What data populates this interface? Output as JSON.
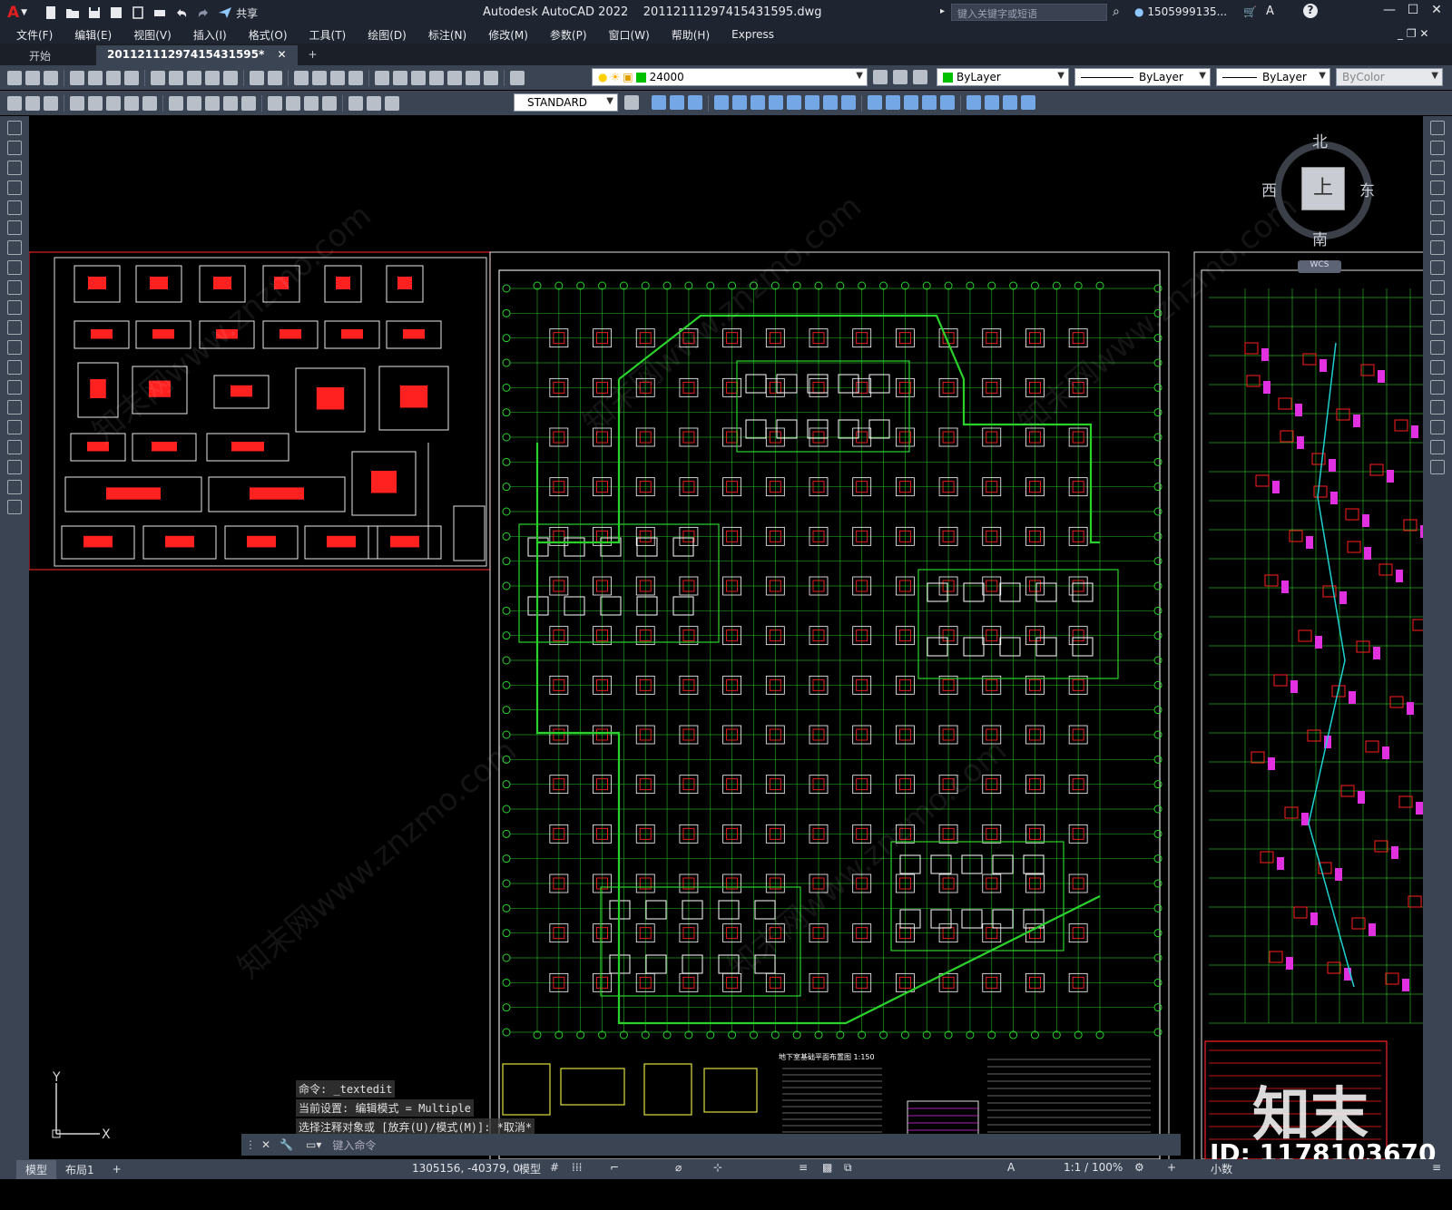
{
  "titlebar": {
    "app": "Autodesk AutoCAD 2022",
    "file": "20112111297415431595.dwg",
    "share": "共享",
    "search_placeholder": "键入关键字或短语",
    "user": "1505999135..."
  },
  "menubar": {
    "items": [
      "文件(F)",
      "编辑(E)",
      "视图(V)",
      "插入(I)",
      "格式(O)",
      "工具(T)",
      "绘图(D)",
      "标注(N)",
      "修改(M)",
      "参数(P)",
      "窗口(W)",
      "帮助(H)",
      "Express"
    ]
  },
  "tabs": {
    "start": "开始",
    "doc": "20112111297415431595*",
    "add": "+"
  },
  "toolbar": {
    "layer": "24000",
    "color": "ByLayer",
    "linetype": "ByLayer",
    "lineweight": "ByLayer",
    "plotstyle": "ByColor",
    "textstyle": "STANDARD"
  },
  "viewcube": {
    "north": "北",
    "south": "南",
    "east": "东",
    "west": "西",
    "top": "上",
    "wcs": "WCS"
  },
  "command": {
    "history": [
      "命令: _textedit",
      "当前设置: 编辑模式 = Multiple",
      "选择注释对象或 [放弃(U)/模式(M)]: *取消*"
    ],
    "placeholder": "键入命令"
  },
  "layout": {
    "model": "模型",
    "layout1": "布局1",
    "add": "+"
  },
  "status": {
    "coords": "1305156, -40379, 0",
    "model": "模型",
    "scale": "1:1 / 100%",
    "units": "小数"
  },
  "drawing": {
    "plan_title": "地下室基础平面布置图",
    "plan_scale": "1:150"
  },
  "watermark": {
    "brand": "知末",
    "id": "ID: 1178103670",
    "site": "知末网www.znzmo.com"
  },
  "colors": {
    "titlebar": "#1e2430",
    "toolbar": "#3b4453",
    "grid": "#2bd12b",
    "column": "#ff2020",
    "accent_magenta": "#e030e0",
    "accent_cyan": "#20d0d0"
  }
}
